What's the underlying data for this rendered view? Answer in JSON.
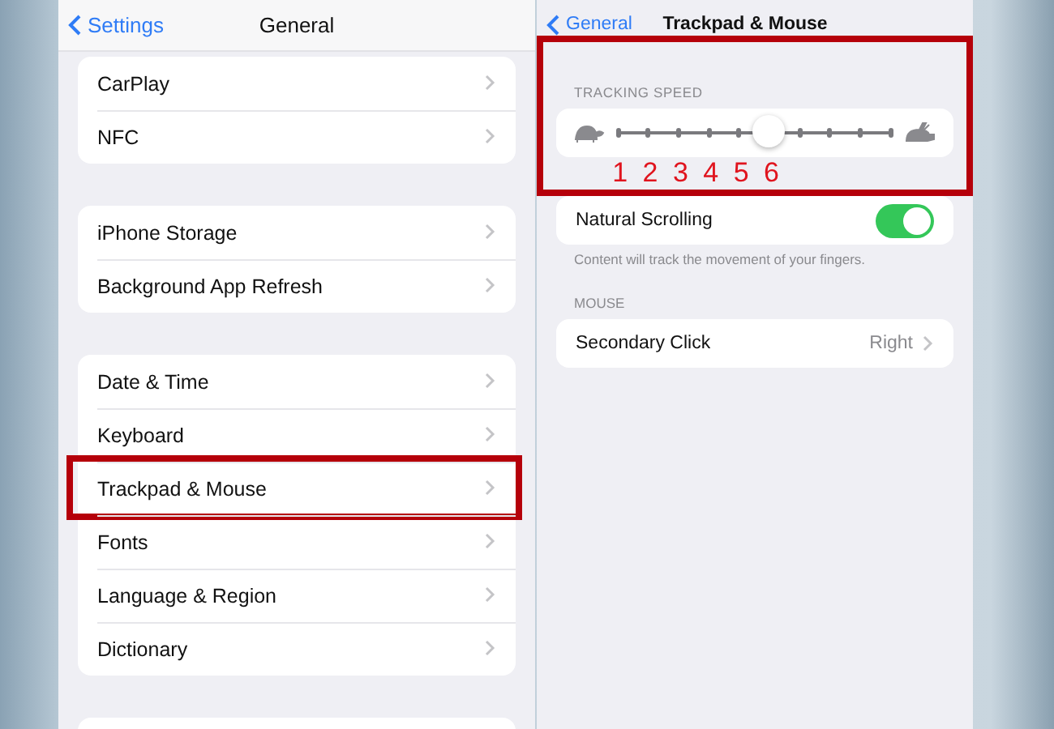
{
  "left": {
    "back": "Settings",
    "title": "General",
    "groups": [
      {
        "items": [
          {
            "label": "CarPlay",
            "highlighted": false
          },
          {
            "label": "NFC",
            "highlighted": false
          }
        ]
      },
      {
        "items": [
          {
            "label": "iPhone Storage",
            "highlighted": false
          },
          {
            "label": "Background App Refresh",
            "highlighted": false
          }
        ]
      },
      {
        "items": [
          {
            "label": "Date & Time",
            "highlighted": false
          },
          {
            "label": "Keyboard",
            "highlighted": false
          },
          {
            "label": "Trackpad & Mouse",
            "highlighted": true
          },
          {
            "label": "Fonts",
            "highlighted": false
          },
          {
            "label": "Language & Region",
            "highlighted": false
          },
          {
            "label": "Dictionary",
            "highlighted": false
          }
        ]
      }
    ]
  },
  "right": {
    "back": "General",
    "title": "Trackpad & Mouse",
    "tracking_speed": {
      "header": "TRACKING SPEED",
      "level": 0.556,
      "highlighted": true,
      "tick_labels": [
        "1",
        "2",
        "3",
        "4",
        "5",
        "6"
      ]
    },
    "natural_scrolling": {
      "label": "Natural Scrolling",
      "on": true,
      "footer": "Content will track the movement of your fingers."
    },
    "mouse": {
      "header": "MOUSE",
      "label": "Secondary Click",
      "value": "Right"
    }
  }
}
